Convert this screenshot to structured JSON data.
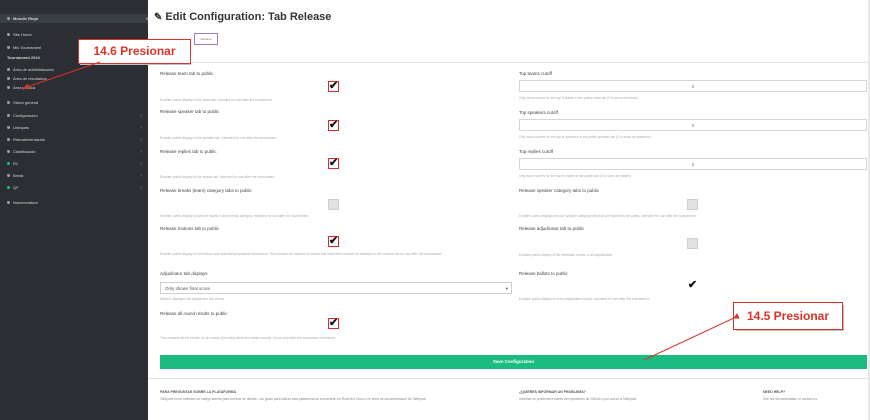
{
  "sidebar": {
    "items": [
      {
        "label": "Moodle Rioja",
        "kind": "head",
        "caret": "◂"
      },
      {
        "label": "Site Home",
        "kind": "sub"
      },
      {
        "label": "Mis Tournament",
        "kind": "sub"
      },
      {
        "label": "Tournament 2024",
        "kind": "section"
      },
      {
        "label": "Área de administración",
        "kind": "sub"
      },
      {
        "label": "Área de resultados",
        "kind": "sub"
      },
      {
        "label": "Área pública",
        "kind": "sub"
      },
      {
        "label": "Visión general",
        "kind": "item"
      },
      {
        "label": "Configuración",
        "kind": "item",
        "caret": "›"
      },
      {
        "label": "Unirques",
        "kind": "item",
        "caret": "›"
      },
      {
        "label": "Retroalimentación",
        "kind": "item",
        "caret": "›"
      },
      {
        "label": "Clasificación",
        "kind": "item",
        "caret": "›"
      },
      {
        "label": "R1",
        "kind": "item-green",
        "caret": "›"
      },
      {
        "label": "Break",
        "kind": "item",
        "caret": "›"
      },
      {
        "label": "QF",
        "kind": "item-green",
        "caret": "›"
      },
      {
        "label": "Nomenclature",
        "kind": "item"
      }
    ]
  },
  "page": {
    "title": "Edit Configuration: Tab Release",
    "tab_label": "Release"
  },
  "left_fields": [
    {
      "label": "Release team tab to public",
      "help": "Enables public display of the team tab. Intended for use after the tournament.",
      "checked": true,
      "highlight": true
    },
    {
      "label": "Release speaker tab to public",
      "help": "Enables public display of the speaker tab. Intended for use after the tournament.",
      "checked": true,
      "highlight": true
    },
    {
      "label": "Release replies tab to public",
      "help": "Enables public display of the replies tab. Intended for use after the tournament.",
      "checked": true,
      "highlight": true
    },
    {
      "label": "Release breaks (team) category tabs to public",
      "help": "Enables public display of tabs for teams in each break category. Intended for use after the tournament.",
      "checked": false,
      "highlight": false
    },
    {
      "label": "Release motions tab to public",
      "help": "Enables public display of all motions and selection/proposition information. This includes all motions in rounds that have been marked as released to the motions tab for use after the tournament.",
      "checked": true,
      "highlight": true
    }
  ],
  "adjudicator_select": {
    "label": "Adjudicator tab displays",
    "value": "Only shows final score",
    "help": "What is displayed the adjudicator tab shows",
    "arrow": "▾"
  },
  "ballots_field": {
    "label": "Release all round results to public",
    "help": "This releases all the results for all rounds (including silent and break rounds). Do so only after the tournament is finished.",
    "checked": true,
    "highlight": true
  },
  "right_fields": [
    {
      "label": "Top teams cutoff",
      "value": "0",
      "help": "Only show scores for the top N teams in the public team tab (0 to show all teams)"
    },
    {
      "label": "Top speakers cutoff",
      "value": "0",
      "help": "Only show scores for the top N speakers in the public speaker tab (0 to show all speakers)"
    },
    {
      "label": "Top replies cutoff",
      "value": "0",
      "help": "Only show scores for the top N replies in the public tab (0 to show all replies)"
    }
  ],
  "right_checks": [
    {
      "label": "Release speaker category tabs to public",
      "help": "Enables public display of those speaker category tabs that are marked to be public. Intended for use after the tournament.",
      "checked": false
    },
    {
      "label": "Release adjudicator tab to public",
      "help": "Enables public display of the feedback results of all adjudicators",
      "checked": false
    },
    {
      "label": "Release ballots to public",
      "help": "Enables public display of every adjudicator's ballot. Intended for use after the tournament.",
      "checked": true
    }
  ],
  "save_button": "Save Configuration",
  "footer": {
    "col1_title": "PARA PREGUNTAS SOBRE LA PLATAFORMA",
    "col1_text": "Tabbycat es un software de código abierto para torneos de debate. Las guías para utilizar esta plataforma se encuentran en Read the Docs o en línea de documentación de Tabbycat.",
    "col2_title": "¿QUIERES INFORMAR UN PROBLEMA?",
    "col2_text": "Informar un problema a través del repositorio de GitHub o por correo a Tabbycat.",
    "col3_title": "NEED HELP?",
    "col3_text": "See our documentation or contact us."
  },
  "callouts": {
    "top": "14.6 Presionar",
    "bottom": "14.5 Presionar"
  },
  "colors": {
    "accent_green": "#1abc82",
    "annotation_red": "#d9342b",
    "sidebar_bg": "#2b2f33"
  }
}
